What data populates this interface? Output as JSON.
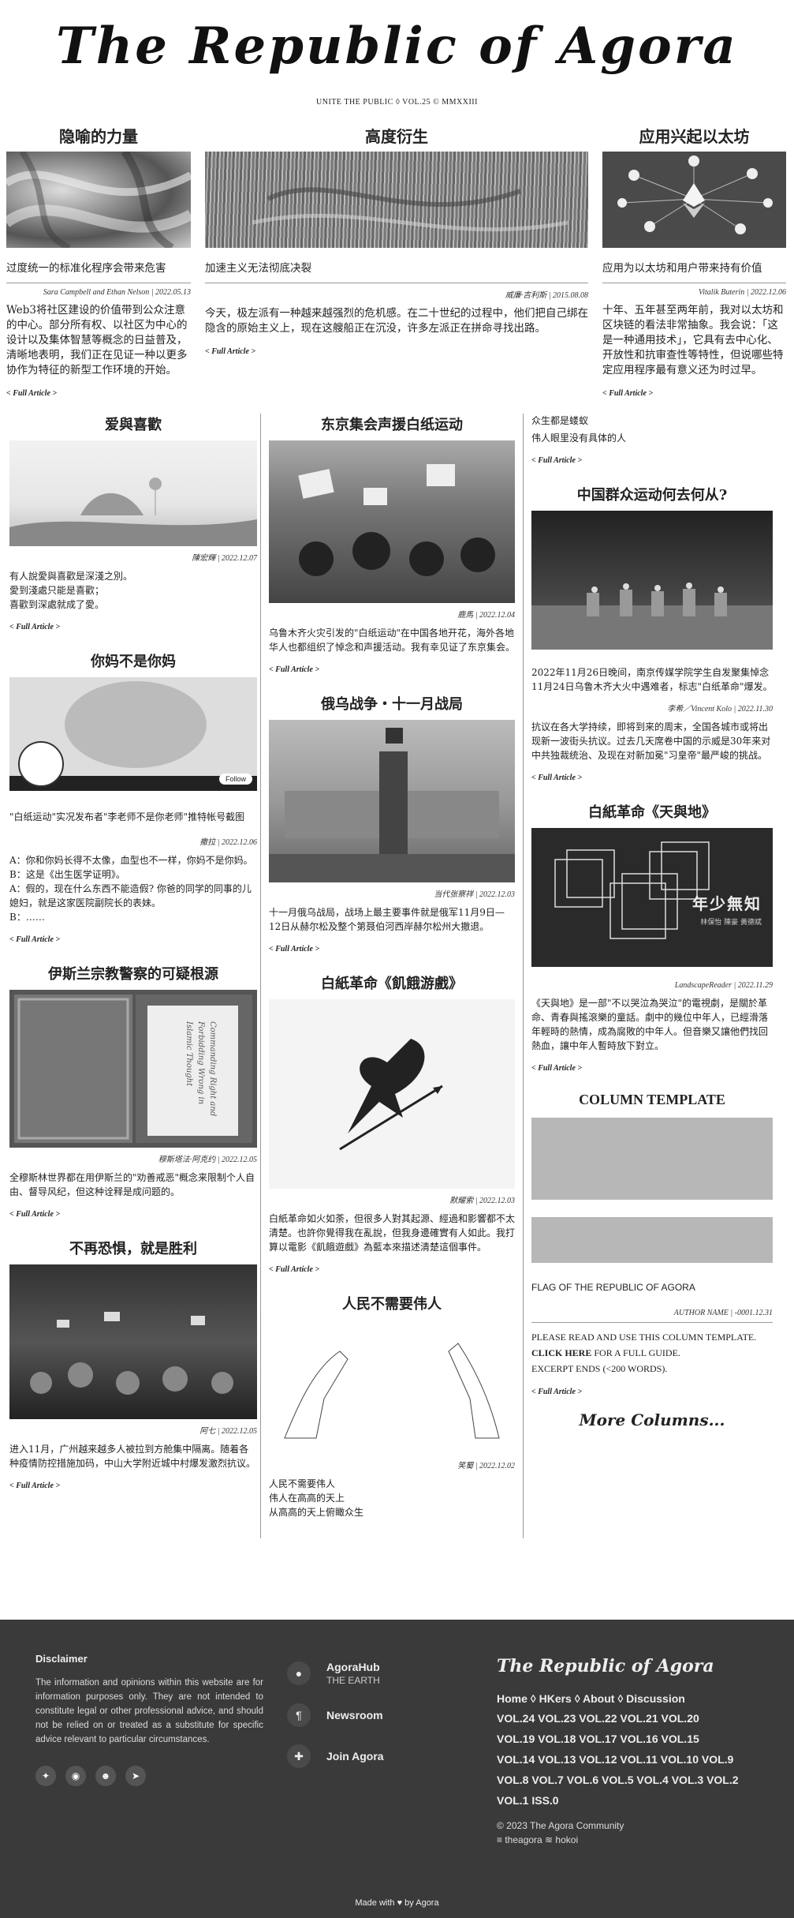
{
  "masthead": {
    "title": "The Republic of Agora",
    "subtitle": "UNITE THE PUBLIC ◊ VOL.25 © MMXXIII"
  },
  "top": [
    {
      "heading": "隐喻的力量",
      "summary": "过度统一的标准化程序会带来危害",
      "byline": "Sara Campbell and Ethan Nelson | 2022.05.13",
      "body": "Web3将社区建设的价值带到公众注意的中心。部分所有权、以社区为中心的设计以及集体智慧等概念的日益普及，清晰地表明，我们正在见证一种以更多协作为特征的新型工作环境的开始。",
      "more": "< Full Article >"
    },
    {
      "heading": "高度衍生",
      "summary": "加速主义无法彻底决裂",
      "byline": "威廉·吉利斯 | 2015.08.08",
      "body": "今天，极左派有一种越来越强烈的危机感。在二十世纪的过程中，他们把自己绑在隐含的原始主义上，现在这艘船正在沉没，许多左派正在拼命寻找出路。",
      "more": "< Full Article >"
    },
    {
      "heading": "应用兴起以太坊",
      "summary": "应用为以太坊和用户带来持有价值",
      "byline": "Vitalik Buterin | 2022.12.06",
      "body": "十年、五年甚至两年前，我对以太坊和区块链的看法非常抽象。我会说：「这是一种通用技术」，它具有去中心化、开放性和抗审查性等特性，但说哪些特定应用程序最有意义还为时过早。",
      "more": "< Full Article >"
    }
  ],
  "col1": [
    {
      "heading": "爱與喜歡",
      "byline": "陳宏輝 | 2022.12.07",
      "lines": [
        "有人說愛與喜歡是深淺之別。",
        "愛到淺處只能是喜歡；",
        "喜歡到深處就成了愛。"
      ],
      "more": "< Full Article >"
    },
    {
      "heading": "你妈不是你妈",
      "follow": "Follow",
      "caption": "\"白纸运动\"实况发布者\"李老师不是你老师\"推特帐号截图",
      "byline": "撒拉 | 2022.12.06",
      "lines": [
        "A：你和你妈长得不太像，血型也不一样，你妈不是你妈。",
        "B：这是《出生医学证明》。",
        "A：假的，现在什么东西不能造假? 你爸的同学的同事的儿媳妇，就是这家医院副院长的表妹。",
        "B：……"
      ],
      "more": "< Full Article >"
    },
    {
      "heading": "伊斯兰宗教警察的可疑根源",
      "book_text": "Commanding Right and Forbidding Wrong in Islamic Thought",
      "byline": "穆斯塔法·阿克约 | 2022.12.05",
      "body": "全穆斯林世界都在用伊斯兰的\"劝善戒恶\"概念来限制个人自由、督导风纪，但这种诠释是成问题的。",
      "more": "< Full Article >"
    },
    {
      "heading": "不再恐惧，就是胜利",
      "byline": "阿七 | 2022.12.05",
      "body": "进入11月，广州越来越多人被拉到方舱集中隔离。随着各种疫情防控措施加码，中山大学附近城中村爆发激烈抗议。",
      "more": "< Full Article >"
    }
  ],
  "col2": [
    {
      "heading": "东京集会声援白纸运动",
      "byline": "鹿馬 | 2022.12.04",
      "body": "乌鲁木齐火灾引发的\"白纸运动\"在中国各地开花，海外各地华人也都组织了悼念和声援活动。我有幸见证了东京集会。",
      "more": "< Full Article >"
    },
    {
      "heading": "俄乌战争・十一月战局",
      "byline": "当代张察祥 | 2022.12.03",
      "body": "十一月俄乌战局，战场上最主要事件就是俄军11月9日—12日从赫尔松及整个第聂伯河西岸赫尔松州大撤退。",
      "more": "< Full Article >"
    },
    {
      "heading": "白紙革命《飢餓游戲》",
      "byline": "默耀索 | 2022.12.03",
      "body": "白紙革命如火如荼，但很多人對其起源、經過和影響都不太清楚。也許你覺得我在亂說，但我身邊確實有人如此。我打算以電影《飢餓遊戲》為藍本來描述清楚這個事件。",
      "more": "< Full Article >"
    },
    {
      "heading": "人民不需要伟人",
      "byline": "笑蜀 | 2022.12.02",
      "lines": [
        "人民不需要伟人",
        "伟人在高高的天上",
        "从高高的天上俯瞰众生"
      ]
    }
  ],
  "col3": [
    {
      "lines": [
        "众生都是蝼蚁",
        "伟人眼里没有具体的人"
      ],
      "more": "< Full Article >"
    },
    {
      "heading": "中国群众运动何去何从?",
      "summary": "2022年11月26日晚间，南京传媒学院学生自发聚集悼念11月24日乌鲁木齐大火中遇难者，标志\"白纸革命\"爆发。",
      "byline": "李希／Vincent Kolo | 2022.11.30",
      "body": "抗议在各大学持续，即将到来的周末，全国各城市或将出现新一波街头抗议。过去几天席卷中国的示威是30年来对中共独裁统治、及现在对新加冕\"习皇帝\"最严峻的挑战。",
      "more": "< Full Article >"
    },
    {
      "heading": "白紙革命《天與地》",
      "poster_title": "年少無知",
      "poster_names": "林保怡  陳豪  黃德斌",
      "byline": "LandscapeReader | 2022.11.29",
      "body": "《天與地》是一部\"不以哭泣為哭泣\"的電視劇，是關於革命、青春與搖滾樂的童話。劇中的幾位中年人，已經滑落年輕時的熱情，成為腐敗的中年人。但音樂又讓他們找回熱血，讓中年人暫時放下對立。",
      "more": "< Full Article >"
    },
    {
      "heading": "COLUMN TEMPLATE",
      "summary": "FLAG OF THE REPUBLIC OF AGORA",
      "byline": "AUTHOR NAME | -0001.12.31",
      "body1": "PLEASE READ AND USE THIS COLUMN TEMPLATE.",
      "body2_bold": "CLICK HERE",
      "body2_rest": " FOR A FULL GUIDE.",
      "body3": "EXCERPT ENDS (<200 WORDS).",
      "more": "< Full Article >"
    }
  ],
  "more_columns": "More Columns...",
  "footer": {
    "disclaimer_title": "Disclaimer",
    "disclaimer_text": "The information and opinions within this website are for information purposes only. They are not intended to constitute legal or other professional advice, and should not be relied on or treated as a substitute for specific advice relevant to particular circumstances.",
    "links": [
      {
        "title": "AgoraHub",
        "sub": "THE EARTH"
      },
      {
        "title": "Newsroom",
        "sub": ""
      },
      {
        "title": "Join Agora",
        "sub": ""
      }
    ],
    "brand": "The Republic of Agora",
    "nav": "Home ◊ HKers ◊ About ◊ Discussion",
    "vols1": "VOL.24  VOL.23  VOL.22  VOL.21  VOL.20",
    "vols2": "VOL.19  VOL.18  VOL.17  VOL.16  VOL.15",
    "vols3": "VOL.14 VOL.13 VOL.12 VOL.11 VOL.10 VOL.9",
    "vols4": "VOL.8 VOL.7 VOL.6 VOL.5 VOL.4 VOL.3 VOL.2",
    "vols5": "VOL.1 ISS.0",
    "copyright": "© 2023 The Agora Community",
    "handles": "≡ theagora ≋ hokoi",
    "made": "Made with ♥ by Agora"
  }
}
